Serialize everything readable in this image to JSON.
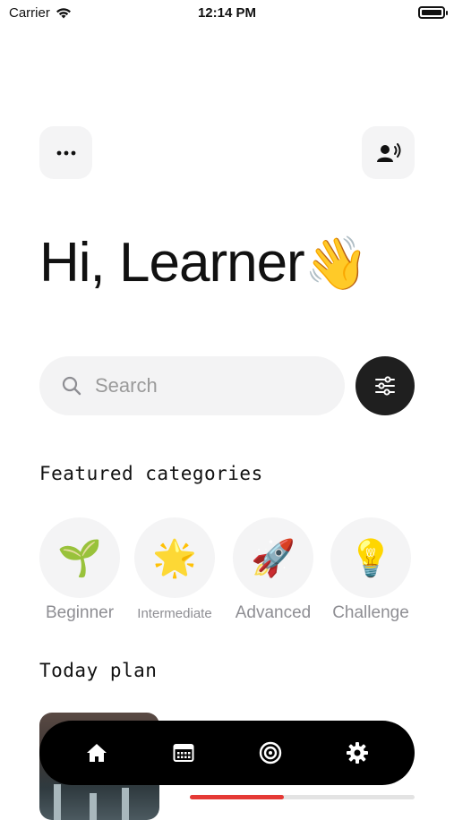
{
  "status_bar": {
    "carrier": "Carrier",
    "time": "12:14 PM"
  },
  "header": {
    "greeting": "Hi, Learner",
    "greeting_emoji": "👋"
  },
  "search": {
    "placeholder": "Search"
  },
  "featured": {
    "title": "Featured categories",
    "categories": [
      {
        "label": "Beginner",
        "emoji": "🌱"
      },
      {
        "label": "Intermediate",
        "emoji": "🌟"
      },
      {
        "label": "Advanced",
        "emoji": "🚀"
      },
      {
        "label": "Challenge",
        "emoji": "💡"
      }
    ]
  },
  "today": {
    "title": "Today plan",
    "progress_fraction": 0.42
  },
  "tabbar": {
    "icons": [
      "home-icon",
      "calendar-icon",
      "target-icon",
      "gear-icon"
    ]
  },
  "colors": {
    "accent": "#e53935",
    "dark": "#1f1f1f",
    "surface": "#f4f4f5"
  }
}
